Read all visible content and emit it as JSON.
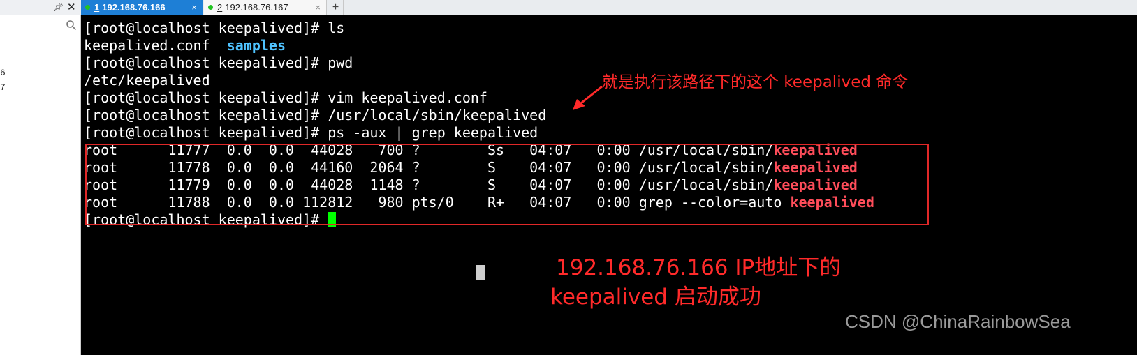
{
  "sidebar": {
    "sessions": [
      "6",
      "7"
    ]
  },
  "tabs": [
    {
      "number": "1",
      "label": "192.168.76.166",
      "active": true,
      "status_color": "#22c322"
    },
    {
      "number": "2",
      "label": "192.168.76.167",
      "active": false,
      "status_color": "#22c322"
    }
  ],
  "tab_close_symbol": "×",
  "add_tab_symbol": "+",
  "terminal": {
    "lines": [
      {
        "text": "[root@localhost keepalived]# ls"
      },
      {
        "text": "keepalived.conf  ",
        "dir": "samples"
      },
      {
        "text": "[root@localhost keepalived]# pwd"
      },
      {
        "text": "/etc/keepalived"
      },
      {
        "text": "[root@localhost keepalived]# vim keepalived.conf"
      },
      {
        "text": "[root@localhost keepalived]# /usr/local/sbin/keepalived"
      },
      {
        "text": "[root@localhost keepalived]# ps -aux | grep keepalived"
      },
      {
        "text": "root      11777  0.0  0.0  44028   700 ?        Ss   04:07   0:00 /usr/local/sbin/",
        "match": "keepalived"
      },
      {
        "text": "root      11778  0.0  0.0  44160  2064 ?        S    04:07   0:00 /usr/local/sbin/",
        "match": "keepalived"
      },
      {
        "text": "root      11779  0.0  0.0  44028  1148 ?        S    04:07   0:00 /usr/local/sbin/",
        "match": "keepalived"
      },
      {
        "text": "root      11788  0.0  0.0 112812   980 pts/0    R+   04:07   0:00 grep --color=auto ",
        "match": "keepalived"
      },
      {
        "text": "[root@localhost keepalived]# "
      }
    ]
  },
  "annotations": {
    "note_command": "就是执行该路径下的这个 keepalived 命令",
    "note_success_line1": "192.168.76.166 IP地址下的",
    "note_success_line2": "keepalived 启动成功"
  },
  "watermark": "CSDN @ChinaRainbowSea",
  "colors": {
    "terminal_bg": "#000000",
    "active_tab": "#1e7fd6",
    "directory": "#4fc3ff",
    "grep_match": "#ff4d5a",
    "annotation": "#ff2a2a",
    "cursor": "#00ff00"
  }
}
